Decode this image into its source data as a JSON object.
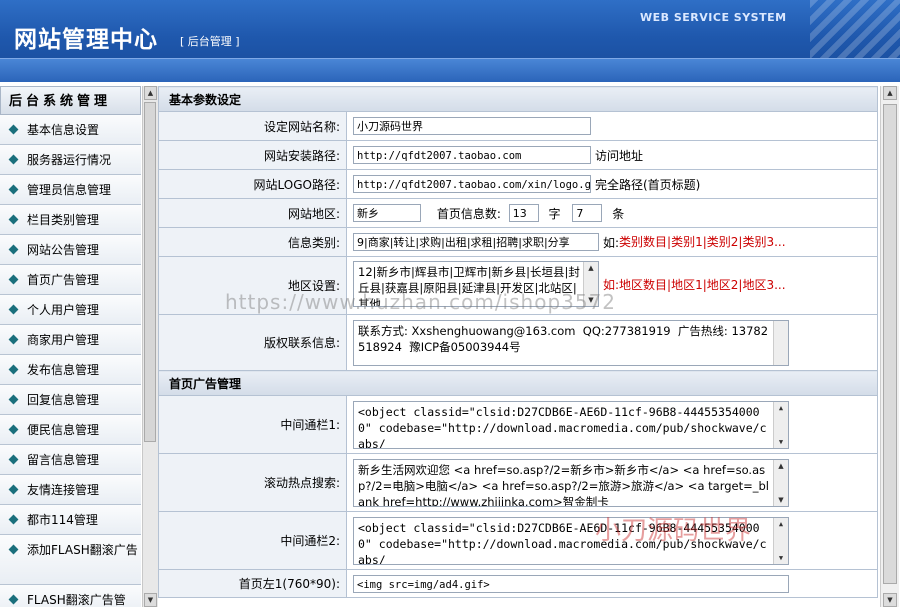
{
  "header": {
    "title": "网站管理中心",
    "subtitle": "[ 后台管理 ]",
    "system": "WEB SERVICE SYSTEM"
  },
  "sidebar": {
    "heading": "后台系统管理",
    "items": [
      "基本信息设置",
      "服务器运行情况",
      "管理员信息管理",
      "栏目类别管理",
      "网站公告管理",
      "首页广告管理",
      "个人用户管理",
      "商家用户管理",
      "发布信息管理",
      "回复信息管理",
      "便民信息管理",
      "留言信息管理",
      "友情连接管理",
      "都市114管理",
      "添加FLASH翻滚广告",
      "FLASH翻滚广告管"
    ]
  },
  "form": {
    "section_basic": "基本参数设定",
    "site_name_label": "设定网站名称:",
    "site_name_value": "小刀源码世界",
    "site_url_label": "网站安装路径:",
    "site_url_value": "http://qfdt2007.taobao.com",
    "site_url_note": "访问地址",
    "logo_label": "网站LOGO路径:",
    "logo_value": "http://qfdt2007.taobao.com/xin/logo.gif",
    "logo_note": "完全路径(首页标题)",
    "region_label": "网站地区:",
    "region_value": "新乡",
    "home_count_label": "首页信息数:",
    "home_count_value": "13",
    "char_unit": "字",
    "item_count_value": "7",
    "item_unit": "条",
    "category_label": "信息类别:",
    "category_value": "9|商家|转让|求购|出租|求租|招聘|求职|分享",
    "category_hint_prefix": "如:",
    "category_hint": "类别数目|类别1|类别2|类别3...",
    "area_label": "地区设置:",
    "area_value": "12|新乡市|辉县市|卫辉市|新乡县|长垣县|封丘县|获嘉县|原阳县|延津县|开发区|北站区|其他",
    "area_hint": "如:地区数目|地区1|地区2|地区3...",
    "copyright_label": "版权联系信息:",
    "copyright_value": "联系方式: Xxshenghuowang@163.com  QQ:277381919  广告热线: 13782518924  豫ICP备05003944号",
    "section_ads": "首页广告管理",
    "mid1_label": "中间通栏1:",
    "mid1_value": "<object classid=\"clsid:D27CDB6E-AE6D-11cf-96B8-444553540000\" codebase=\"http://download.macromedia.com/pub/shockwave/cabs/",
    "scroll_label": "滚动热点搜索:",
    "scroll_value": "新乡生活网欢迎您 <a href=so.asp?/2=新乡市>新乡市</a> <a href=so.asp?/2=电脑>电脑</a> <a href=so.asp?/2=旅游>旅游</a> <a target=_blank href=http://www.zhijinka.com>智金制卡",
    "mid2_label": "中间通栏2:",
    "mid2_value": "<object classid=\"clsid:D27CDB6E-AE6D-11cf-96B8-444553540000\" codebase=\"http://download.macromedia.com/pub/shockwave/cabs/",
    "left1_label": "首页左1(760*90):",
    "left1_value": "<img src=img/ad4.gif>"
  },
  "watermarks": {
    "url": "https://www.huzhan.com/ishop3572",
    "brand": "小刀源码世界"
  }
}
